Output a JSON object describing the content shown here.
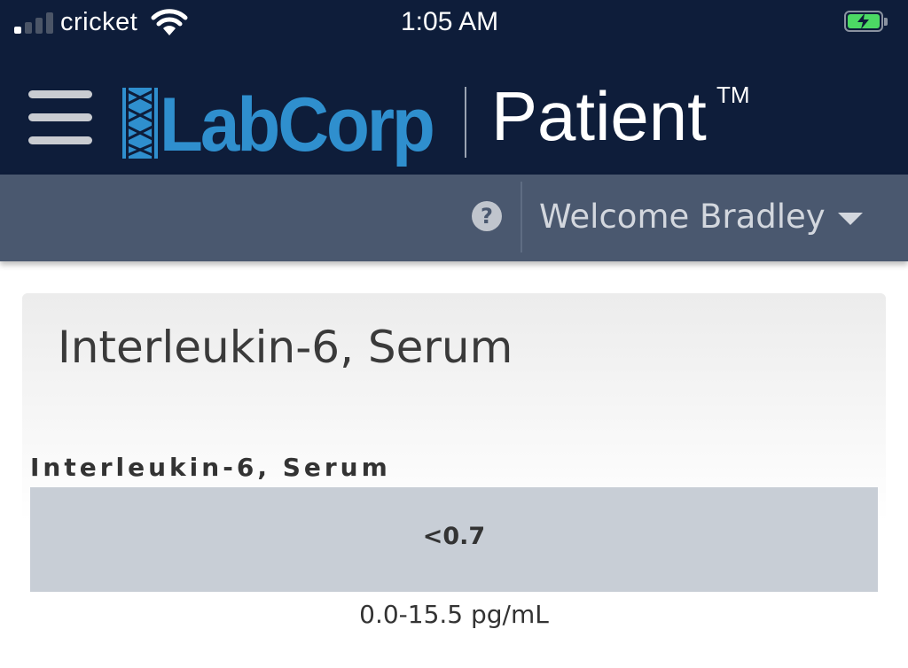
{
  "status_bar": {
    "carrier": "cricket",
    "time": "1:05 AM",
    "signal_bars_on": 1,
    "signal_bars_total": 4,
    "battery_charging": true,
    "colors": {
      "battery": "#4cd964"
    }
  },
  "header": {
    "menu_icon": "hamburger-icon",
    "logo_text": "LabCorp",
    "product_name": "Patient",
    "trademark": "TM",
    "colors": {
      "background": "#0e1d3a",
      "logo": "#2f8fce"
    }
  },
  "welcome_bar": {
    "help_icon": "question-circle-icon",
    "help_glyph": "?",
    "welcome_text": "Welcome Bradley",
    "dropdown_icon": "caret-down-icon",
    "colors": {
      "background": "#4a586f"
    }
  },
  "result_card": {
    "title": "Interleukin-6, Serum",
    "test_name": "Interleukin-6, Serum",
    "value": "<0.7",
    "reference_range": "0.0-15.5 pg/mL"
  }
}
